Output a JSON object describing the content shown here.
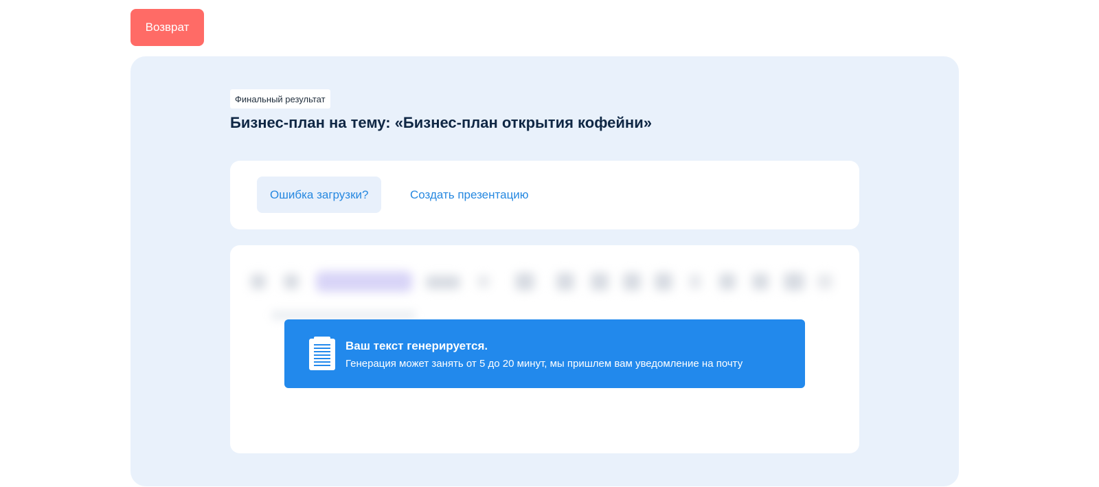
{
  "header": {
    "back_label": "Возврат"
  },
  "result": {
    "tag": "Финальный результат",
    "title": "Бизнес-план на тему: «Бизнес-план открытия кофейни»"
  },
  "actions": {
    "error_label": "Ошибка загрузки?",
    "presentation_label": "Создать презентацию"
  },
  "notice": {
    "icon": "document-lines-icon",
    "title": "Ваш текст генерируется.",
    "text": "Генерация может занять от 5 до 20 минут, мы пришлем вам уведомление на почту"
  },
  "colors": {
    "back_button": "#ff6b66",
    "panel_bg": "#e9f1fb",
    "accent": "#2688e0",
    "notice_bg": "#2289ec",
    "title": "#0f2744"
  }
}
